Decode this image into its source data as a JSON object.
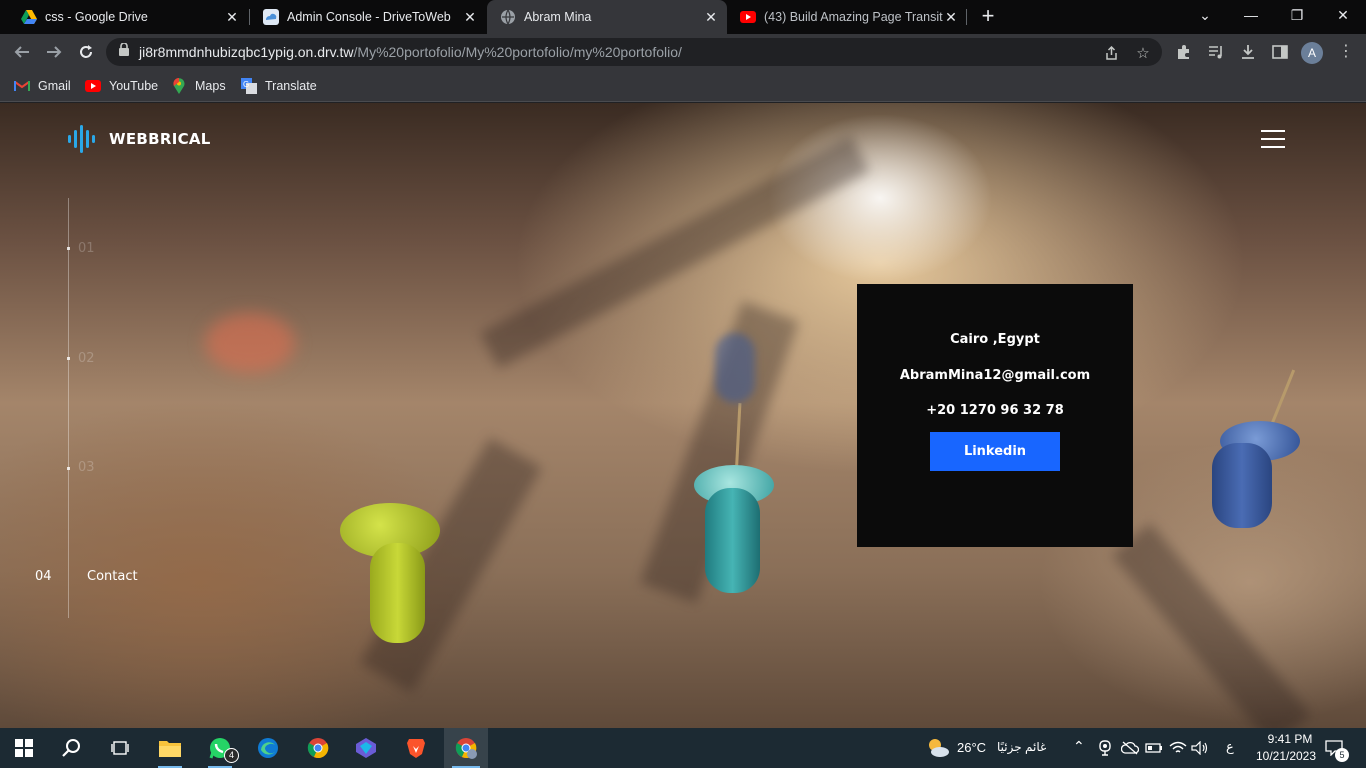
{
  "browser": {
    "tabs": [
      {
        "title": "css - Google Drive",
        "icon": "google-drive-icon"
      },
      {
        "title": "Admin Console - DriveToWeb",
        "icon": "drivetoweb-icon"
      },
      {
        "title": "Abram Mina",
        "icon": "globe-icon"
      },
      {
        "title": "(43) Build Amazing Page Transiti",
        "icon": "youtube-icon"
      }
    ],
    "new_tab": "+",
    "url_host": "ji8r8mmdnhubizqbc1ypig.on.drv.tw",
    "url_path": "/My%20portofolio/My%20portofolio/my%20portofolio/",
    "profile_initial": "A"
  },
  "bookmarks": [
    {
      "label": "Gmail",
      "icon": "gmail-icon"
    },
    {
      "label": "YouTube",
      "icon": "youtube-icon"
    },
    {
      "label": "Maps",
      "icon": "maps-icon"
    },
    {
      "label": "Translate",
      "icon": "translate-icon"
    }
  ],
  "site": {
    "logo": "WEBBRICAL",
    "sections": [
      {
        "num": "01"
      },
      {
        "num": "02"
      },
      {
        "num": "03"
      }
    ],
    "current": {
      "num": "04",
      "label": "Contact"
    },
    "contact": {
      "location": "Cairo ,Egypt",
      "email": "AbramMina12@gmail.com",
      "phone": "+20 1270 96 32 78",
      "button": "Linkedin"
    }
  },
  "taskbar": {
    "whatsapp_badge": "4",
    "weather_temp": "26°C",
    "weather_text": "غائم جزئيًا",
    "lang": "ع",
    "time": "9:41 PM",
    "date": "10/21/2023",
    "notifications": "5"
  }
}
